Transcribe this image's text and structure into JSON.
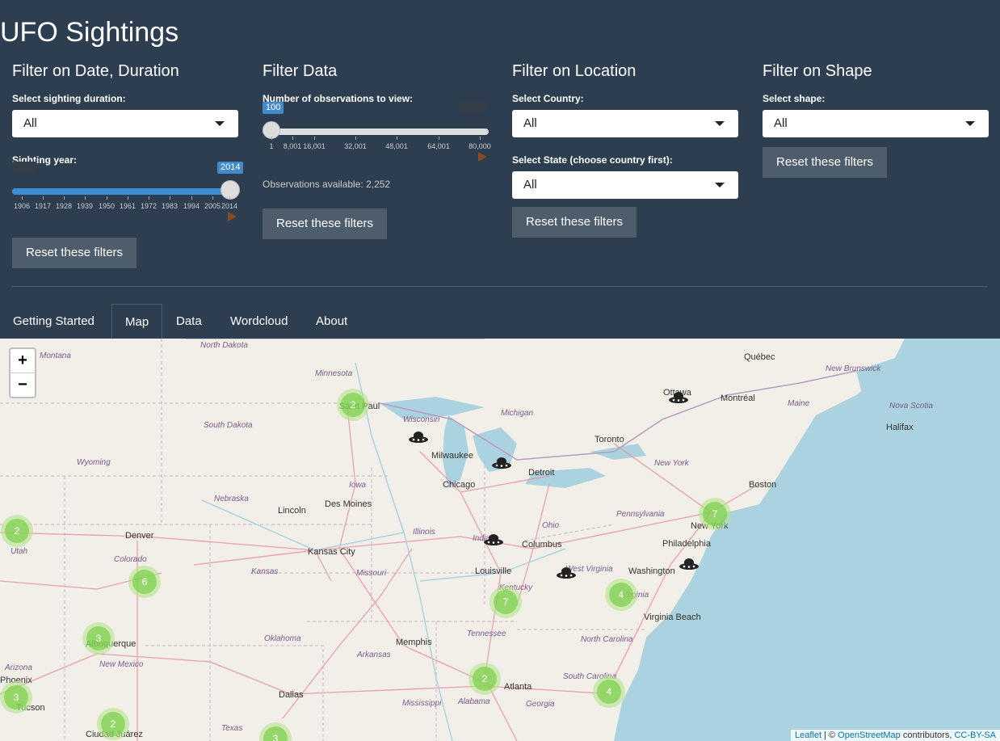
{
  "app": {
    "title": "UFO Sightings"
  },
  "date_panel": {
    "heading": "Filter on Date, Duration",
    "duration_label": "Select sighting duration:",
    "duration_value": "All",
    "year_label": "Sighting year:",
    "year_value": "2014",
    "year_ticks": [
      "1906",
      "1917",
      "1928",
      "1939",
      "1950",
      "1961",
      "1972",
      "1983",
      "1994",
      "2005",
      "2014"
    ],
    "reset_label": "Reset these filters"
  },
  "data_panel": {
    "heading": "Filter Data",
    "obs_label": "Number of observations to view:",
    "obs_value": "100",
    "obs_ticks": [
      "1",
      "8,001",
      "16,001",
      "32,001",
      "48,001",
      "64,001",
      "80,000"
    ],
    "available_text": "Observations available: 2,252",
    "reset_label": "Reset these filters"
  },
  "location_panel": {
    "heading": "Filter on Location",
    "country_label": "Select Country:",
    "country_value": "All",
    "state_label": "Select State (choose country first):",
    "state_value": "All",
    "reset_label": "Reset these filters"
  },
  "shape_panel": {
    "heading": "Filter on Shape",
    "shape_label": "Select shape:",
    "shape_value": "All",
    "reset_label": "Reset these filters"
  },
  "tabs": [
    "Getting Started",
    "Map",
    "Data",
    "Wordcloud",
    "About"
  ],
  "active_tab": "Map",
  "map": {
    "zoom_in": "+",
    "zoom_out": "−",
    "attribution": {
      "leaflet": "Leaflet",
      "sep": " | © ",
      "osm": "OpenStreetMap",
      "contrib": " contributors, ",
      "license": "CC-BY-SA"
    },
    "cities": [
      "Québec",
      "Ottawa",
      "Montréal",
      "Halifax",
      "Toronto",
      "Boston",
      "New York",
      "Philadelphia",
      "Washington",
      "Virginia Beach",
      "Detroit",
      "Milwaukee",
      "Chicago",
      "Saint Paul",
      "Des Moines",
      "Lincoln",
      "Kansas City",
      "Denver",
      "Columbus",
      "Louisville",
      "Memphis",
      "Atlanta",
      "Dallas",
      "Albuquerque",
      "Tucson",
      "Phoenix",
      "Ciudad Juárez"
    ],
    "regions": [
      "Montana",
      "North Dakota",
      "Minnesota",
      "South Dakota",
      "Wisconsin",
      "Michigan",
      "Wyoming",
      "Nebraska",
      "Iowa",
      "Illinois",
      "Indiana",
      "Ohio",
      "Pennsylvania",
      "New York",
      "New Brunswick",
      "Maine",
      "Nova Scotia",
      "Colorado",
      "Kansas",
      "Missouri",
      "Utah",
      "Kentucky",
      "West Virginia",
      "Virginia",
      "Tennessee",
      "North Carolina",
      "South Carolina",
      "Oklahoma",
      "Arkansas",
      "Mississippi",
      "Alabama",
      "Georgia",
      "New Mexico",
      "Arizona",
      "Texas"
    ],
    "cluster_counts": [
      "2",
      "7",
      "2",
      "6",
      "3",
      "3",
      "2",
      "3",
      "7",
      "4",
      "2",
      "4"
    ],
    "marker_icon": "ufo-icon"
  }
}
